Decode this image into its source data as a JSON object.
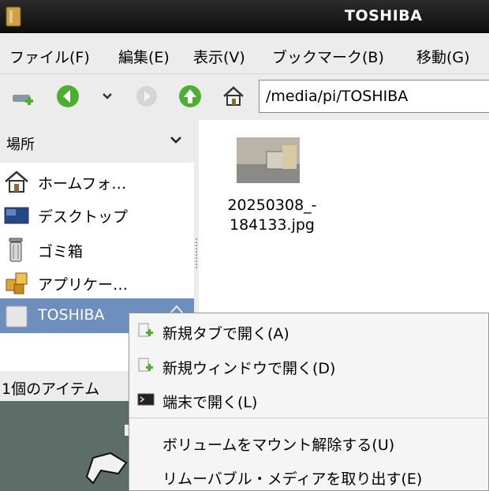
{
  "window": {
    "title": "TOSHIBA"
  },
  "menubar": {
    "items": [
      "ファイル(F)",
      "編集(E)",
      "表示(V)",
      "ブックマーク(B)",
      "移動(G)"
    ]
  },
  "toolbar": {
    "address": "/media/pi/TOSHIBA"
  },
  "sidebar": {
    "header": "場所",
    "places": [
      {
        "label": "ホームフォ…",
        "icon": "home-icon"
      },
      {
        "label": "デスクトップ",
        "icon": "desktop-icon"
      },
      {
        "label": "ゴミ箱",
        "icon": "trash-icon"
      },
      {
        "label": "アプリケー…",
        "icon": "applications-icon"
      },
      {
        "label": "TOSHIBA",
        "icon": "drive-icon",
        "selected": true
      }
    ]
  },
  "status": {
    "text": "1個のアイテム"
  },
  "files": [
    {
      "name_line1": "20250308_-",
      "name_line2": "184133.jpg"
    }
  ],
  "context_menu": {
    "items": [
      {
        "label": "新規タブで開く(A)",
        "icon": "new-tab-icon"
      },
      {
        "label": "新規ウィンドウで開く(D)",
        "icon": "new-window-icon"
      },
      {
        "label": "端末で開く(L)",
        "icon": "terminal-icon"
      },
      {
        "label": "ボリュームをマウント解除する(U)"
      },
      {
        "label": "リムーバブル・メディアを取り出す(E)"
      }
    ]
  },
  "colors": {
    "selection": "#6e8fbd",
    "titlebar": "#1a1a1a",
    "accent_green": "#4caf2f"
  }
}
